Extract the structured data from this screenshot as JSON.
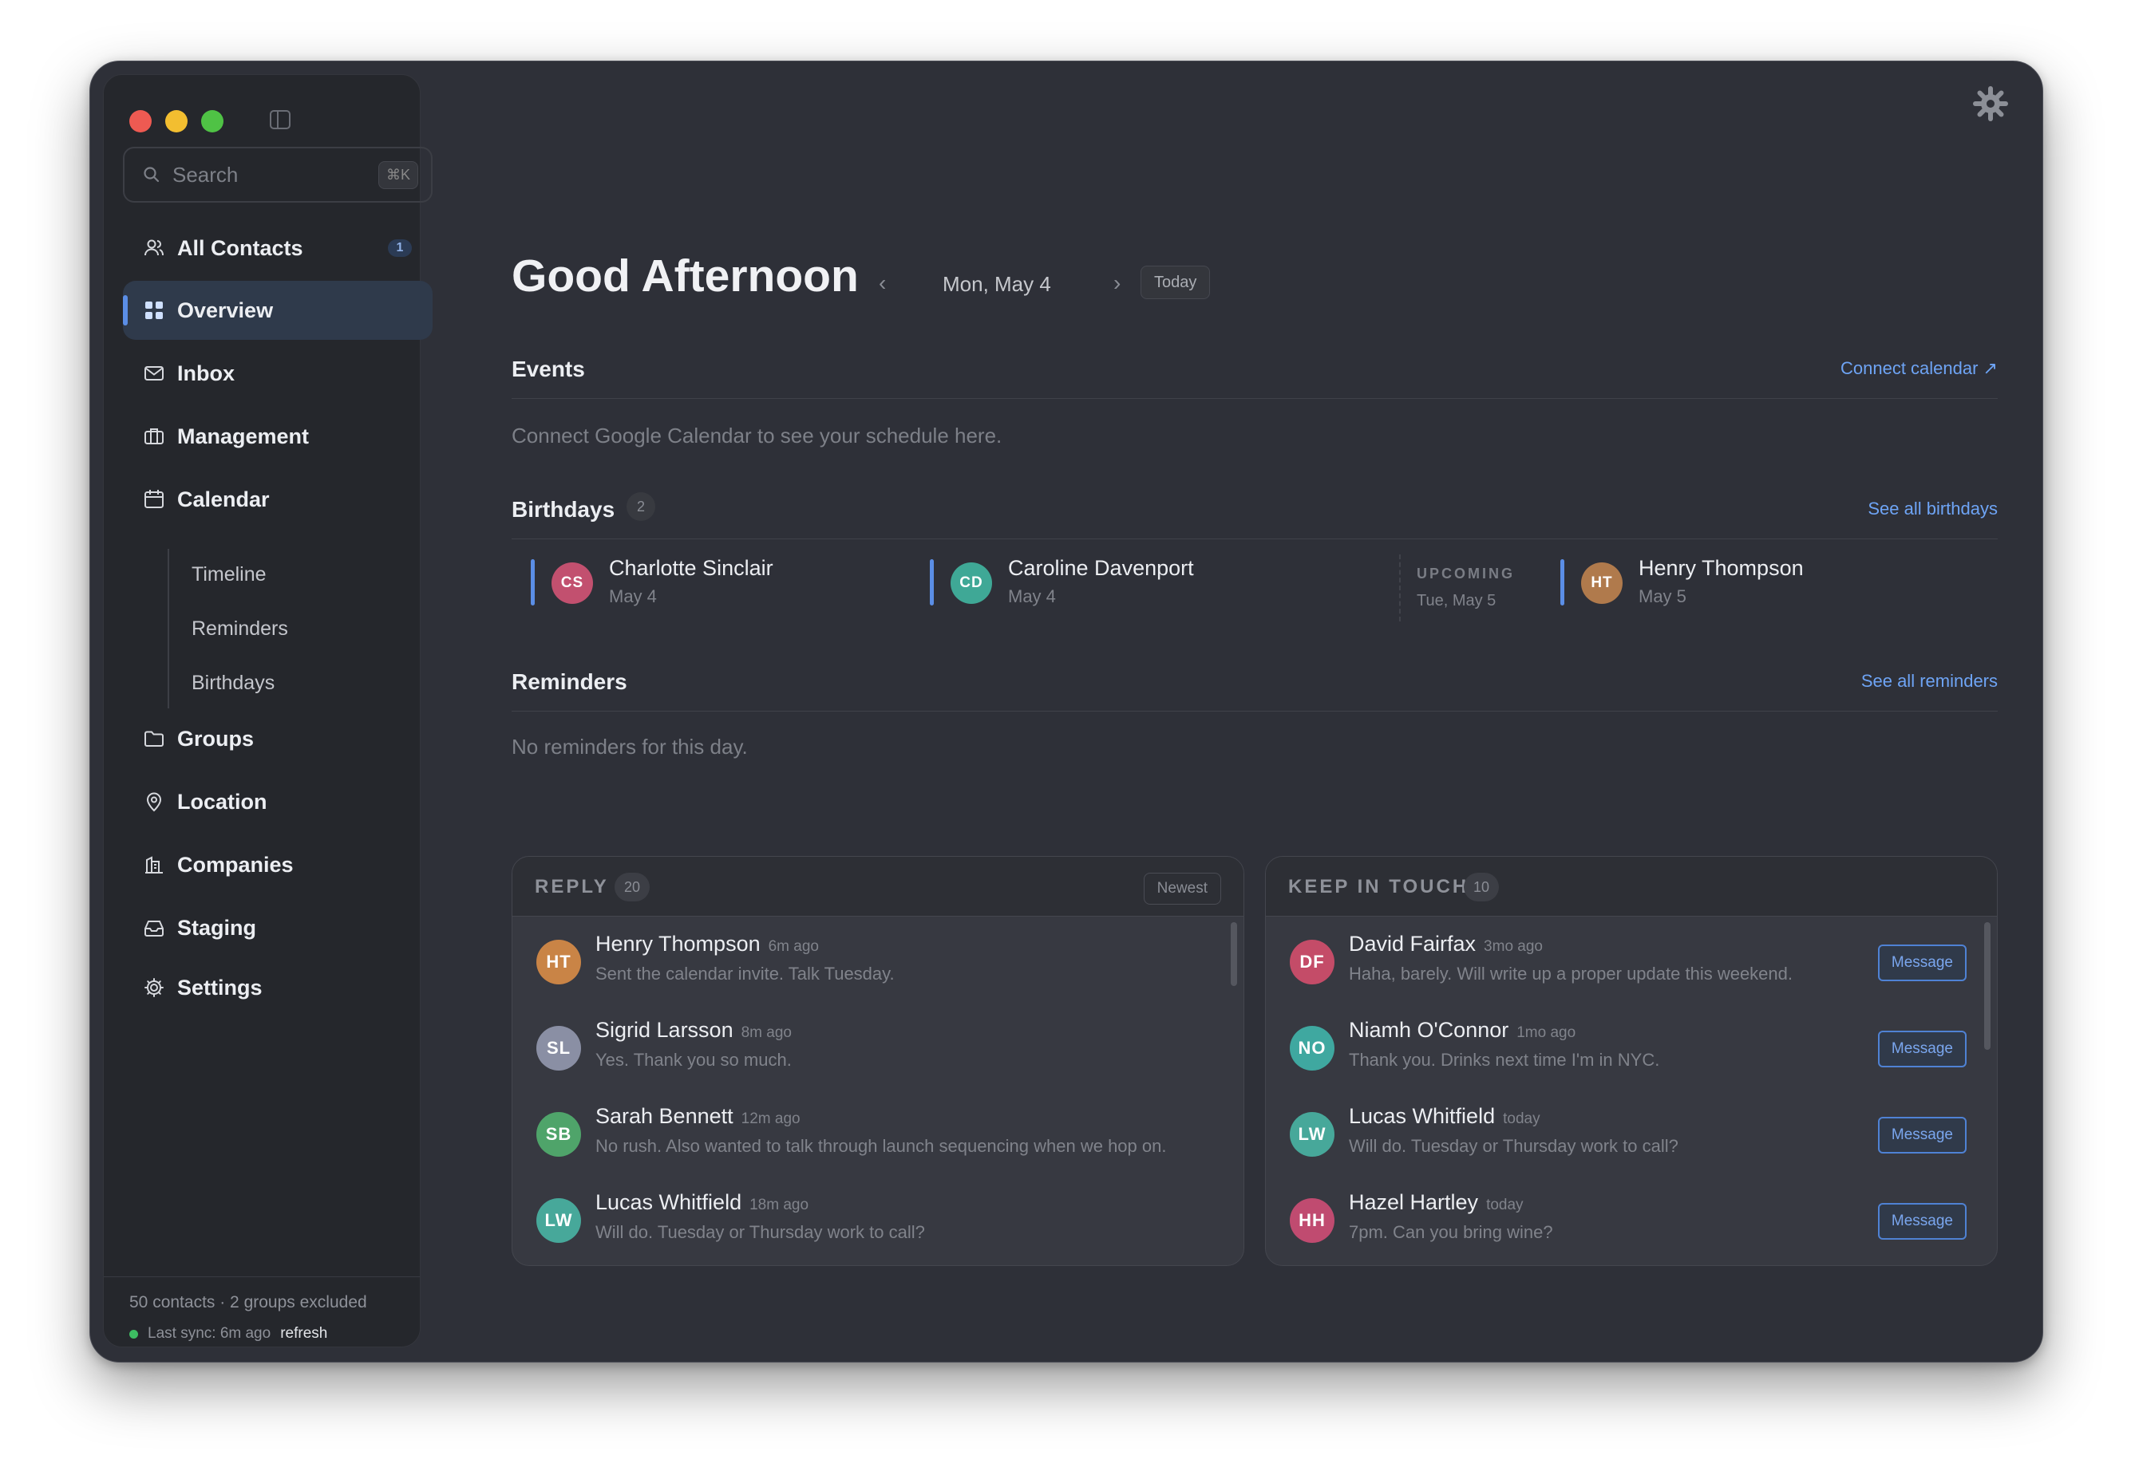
{
  "sidebar": {
    "search": {
      "placeholder": "Search",
      "shortcut": "⌘K"
    },
    "nav": [
      {
        "label": "All Contacts",
        "icon": "users-icon",
        "badge": "1"
      },
      {
        "label": "Overview",
        "icon": "grid-icon",
        "active": true
      },
      {
        "label": "Inbox",
        "icon": "mail-icon"
      },
      {
        "label": "Management",
        "icon": "briefcase-icon"
      },
      {
        "label": "Calendar",
        "icon": "calendar-icon"
      },
      {
        "label": "Groups",
        "icon": "folder-icon"
      },
      {
        "label": "Location",
        "icon": "map-pin-icon"
      },
      {
        "label": "Companies",
        "icon": "building-icon"
      },
      {
        "label": "Staging",
        "icon": "inbox-tray-icon"
      },
      {
        "label": "Settings",
        "icon": "gear-icon"
      }
    ],
    "calendar_sub": [
      "Timeline",
      "Reminders",
      "Birthdays"
    ],
    "footer": {
      "summary": "50 contacts · 2 groups excluded",
      "sync": "Last sync: 6m ago",
      "refresh": "refresh"
    }
  },
  "header": {
    "greeting": "Good Afternoon",
    "date": "Mon, May 4",
    "today": "Today"
  },
  "events": {
    "title": "Events",
    "link": "Connect calendar ↗",
    "empty": "Connect Google Calendar to see your schedule here."
  },
  "birthdays": {
    "title": "Birthdays",
    "count": "2",
    "link": "See all birthdays",
    "today": [
      {
        "initials": "CS",
        "name": "Charlotte Sinclair",
        "date": "May 4",
        "color": "#c2506f"
      },
      {
        "initials": "CD",
        "name": "Caroline Davenport",
        "date": "May 4",
        "color": "#3fa896"
      }
    ],
    "upcoming_label": "UPCOMING",
    "upcoming_date": "Tue, May 5",
    "upcoming": [
      {
        "initials": "HT",
        "name": "Henry Thompson",
        "date": "May 5",
        "color": "#b07a4c"
      }
    ]
  },
  "reminders": {
    "title": "Reminders",
    "link": "See all reminders",
    "empty": "No reminders for this day."
  },
  "reply": {
    "title": "REPLY",
    "count": "20",
    "sort": "Newest",
    "items": [
      {
        "initials": "HT",
        "name": "Henry Thompson",
        "time": "6m ago",
        "msg": "Sent the calendar invite. Talk Tuesday.",
        "color": "#c98446"
      },
      {
        "initials": "SL",
        "name": "Sigrid Larsson",
        "time": "8m ago",
        "msg": "Yes. Thank you so much.",
        "color": "#8a8fa4"
      },
      {
        "initials": "SB",
        "name": "Sarah Bennett",
        "time": "12m ago",
        "msg": "No rush. Also wanted to talk through launch sequencing when we hop on.",
        "color": "#4fa46a"
      },
      {
        "initials": "LW",
        "name": "Lucas Whitfield",
        "time": "18m ago",
        "msg": "Will do. Tuesday or Thursday work to call?",
        "color": "#47a89a"
      }
    ]
  },
  "keep_in_touch": {
    "title": "KEEP IN TOUCH",
    "count": "10",
    "button": "Message",
    "items": [
      {
        "initials": "DF",
        "name": "David Fairfax",
        "time": "3mo ago",
        "msg": "Haha, barely. Will write up a proper update this weekend.",
        "color": "#c44c68"
      },
      {
        "initials": "NO",
        "name": "Niamh O'Connor",
        "time": "1mo ago",
        "msg": "Thank you. Drinks next time I'm in NYC.",
        "color": "#3fa8a0"
      },
      {
        "initials": "LW",
        "name": "Lucas Whitfield",
        "time": "today",
        "msg": "Will do. Tuesday or Thursday work to call?",
        "color": "#47a89a"
      },
      {
        "initials": "HH",
        "name": "Hazel Hartley",
        "time": "today",
        "msg": "7pm. Can you bring wine?",
        "color": "#c04b70"
      }
    ]
  }
}
